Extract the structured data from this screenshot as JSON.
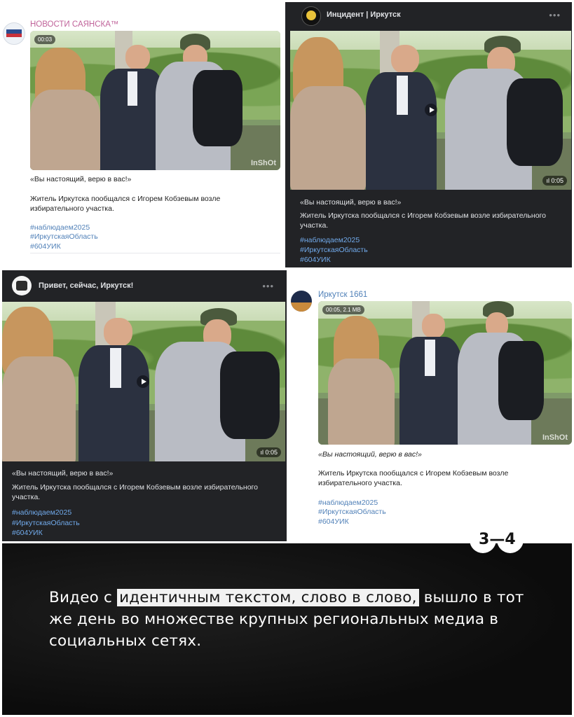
{
  "posts": [
    {
      "channel": "НОВОСТИ САЯНСКА™",
      "video_badge": "00:03",
      "watermark": "InShOt",
      "quote": "«Вы настоящий, верю в вас!»",
      "body": "Житель Иркутска пообщался с Игорем Кобзевым возле избирательного участка.",
      "tags": [
        "#наблюдаем2025",
        "#ИркутскаяОбласть",
        "#604УИК"
      ],
      "colors": {
        "channel": "#c0639a",
        "tags": "#5181b8"
      }
    },
    {
      "channel": "Инцидент | Иркутск",
      "more": "•••",
      "duration": "0:05",
      "quote": "«Вы настоящий, верю в вас!»",
      "body": "Житель Иркутска пообщался с Игорем Кобзевым возле избирательного участка.",
      "tags": [
        "#наблюдаем2025",
        "#ИркутскаяОбласть",
        "#604УИК"
      ]
    },
    {
      "channel": "Привет, сейчас, Иркутск!",
      "more": "•••",
      "duration": "0:05",
      "quote": "«Вы настоящий, верю в вас!»",
      "body": "Житель Иркутска пообщался с Игорем Кобзевым возле избирательного участка.",
      "tags": [
        "#наблюдаем2025",
        "#ИркутскаяОбласть",
        "#604УИК"
      ]
    },
    {
      "channel": "Иркутск 1661",
      "video_badge": "00:05, 2.1 MB",
      "watermark": "InShOt",
      "quote": "«Вы настоящий, верю в вас!»",
      "body": "Житель Иркутска пообщался с Игорем Кобзевым возле избирательного участка.",
      "tags": [
        "#наблюдаем2025",
        "#ИркутскаяОбласть",
        "#604УИК"
      ],
      "colors": {
        "channel": "#5181b8"
      }
    }
  ],
  "slide": {
    "current": "3",
    "separator": "—",
    "total": "4"
  },
  "headline": {
    "before": "Видео с ",
    "highlight": "идентичным текстом, слово в слово,",
    "after": " вышло в тот же день во множестве крупных региональных медиа в социальных сетях."
  }
}
